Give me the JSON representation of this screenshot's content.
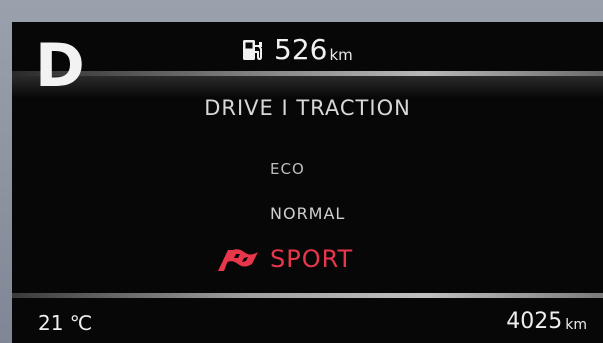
{
  "gear": {
    "indicator": "D"
  },
  "range": {
    "icon": "fuel-pump-icon",
    "value": "526",
    "unit": "km"
  },
  "mode_menu": {
    "title": "DRIVE I TRACTION",
    "items": [
      {
        "label": "ECO",
        "selected": false
      },
      {
        "label": "NORMAL",
        "selected": false
      },
      {
        "label": "SPORT",
        "selected": true,
        "icon": "sport-flag-icon"
      }
    ]
  },
  "status_bar": {
    "temperature": "21 ℃",
    "odometer_value": "4025",
    "odometer_unit": "km"
  },
  "colors": {
    "screen_background": "#070707",
    "selected_accent": "#e8364a",
    "text_primary": "#eeeeee",
    "bezel": "#8d95a3"
  }
}
